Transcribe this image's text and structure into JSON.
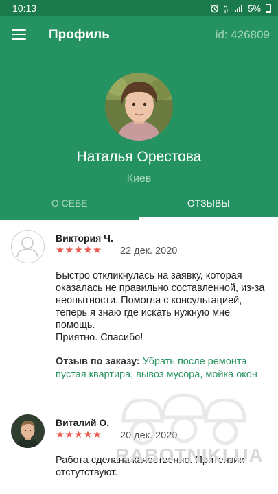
{
  "status_bar": {
    "time": "10:13",
    "battery": "5%"
  },
  "app_bar": {
    "title": "Профиль",
    "id": "id: 426809"
  },
  "profile": {
    "name": "Наталья Орестова",
    "city": "Киев"
  },
  "tabs": [
    {
      "label": "О СЕБЕ",
      "active": false
    },
    {
      "label": "ОТЗЫВЫ",
      "active": true
    }
  ],
  "reviews": [
    {
      "name": "Виктория Ч.",
      "stars": "★★★★★",
      "rating": 5,
      "date": "22 дек. 2020",
      "text": "Быстро откликнулась на заявку, которая оказалась не правильно составленной, из-за неопытности. Помогла с консультацией, теперь я знаю где искать нужную мне помощь.\nПриятно. Спасибо!",
      "order_label": "Отзыв по заказу:",
      "order_link": "Убрать после ремонта, пустая квартира, вывоз мусора, мойка окон"
    },
    {
      "name": "Виталий О.",
      "stars": "★★★★★",
      "rating": 5,
      "date": "20 дек. 2020",
      "text": "Работа сделана качественно. Притензии отстутствуют."
    }
  ],
  "watermark": "RABOTNIKI.UA",
  "colors": {
    "primary": "#249261",
    "status_bar": "#1b7a4b",
    "stars": "#e85a4f",
    "link": "#2a9462"
  }
}
